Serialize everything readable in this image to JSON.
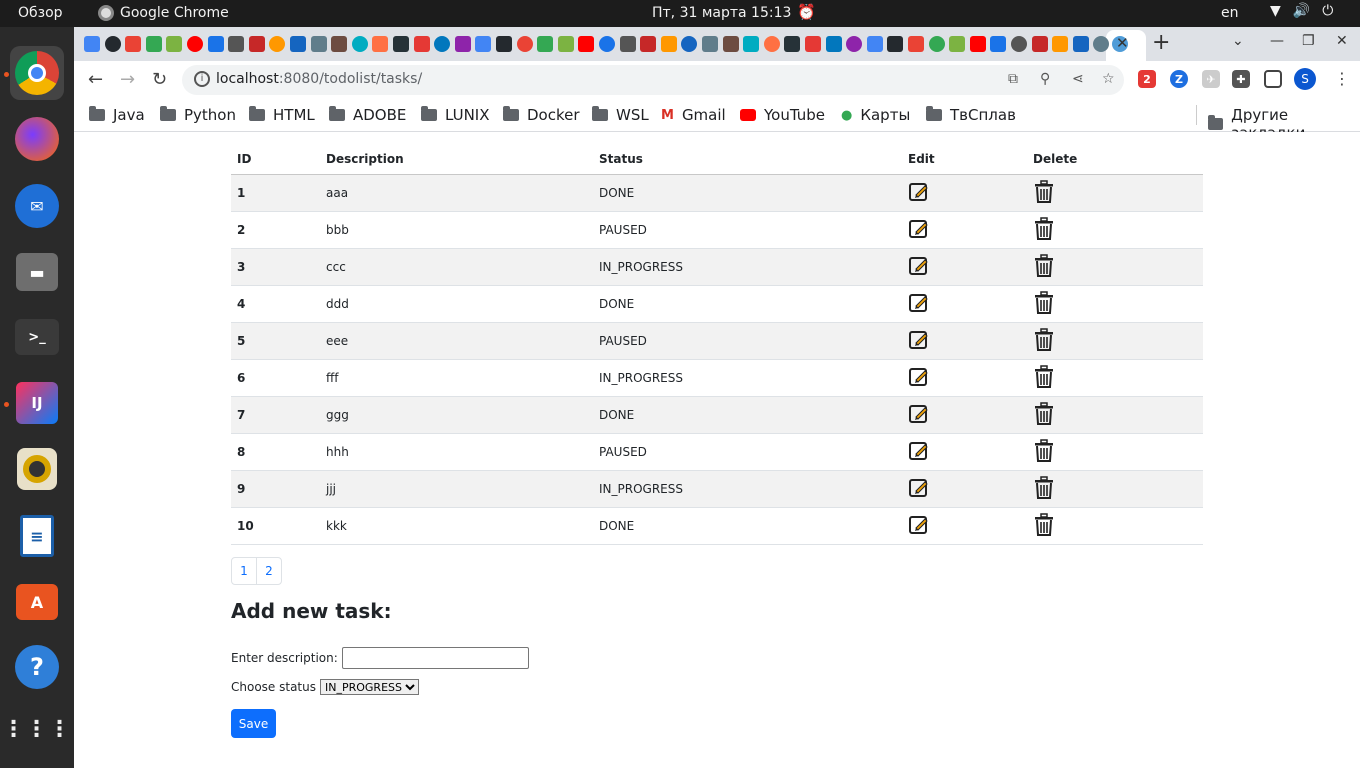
{
  "os": {
    "activities": "Обзор",
    "app_name": "Google Chrome",
    "clock": "Пт, 31 марта  15:13",
    "keyboard_layout": "en"
  },
  "browser": {
    "url_host": "localhost",
    "url_rest": ":8080/todolist/tasks/",
    "profile_initial": "S",
    "bookmarks": [
      "Java",
      "Python",
      "HTML",
      "ADOBE",
      "LUNIX",
      "Docker",
      "WSL",
      "Gmail",
      "YouTube",
      "Карты",
      "ТвСплав"
    ],
    "other_bookmarks": "Другие закладки"
  },
  "table": {
    "headers": {
      "id": "ID",
      "description": "Description",
      "status": "Status",
      "edit": "Edit",
      "delete": "Delete"
    },
    "rows": [
      {
        "id": "1",
        "description": "aaa",
        "status": "DONE"
      },
      {
        "id": "2",
        "description": "bbb",
        "status": "PAUSED"
      },
      {
        "id": "3",
        "description": "ccc",
        "status": "IN_PROGRESS"
      },
      {
        "id": "4",
        "description": "ddd",
        "status": "DONE"
      },
      {
        "id": "5",
        "description": "eee",
        "status": "PAUSED"
      },
      {
        "id": "6",
        "description": "fff",
        "status": "IN_PROGRESS"
      },
      {
        "id": "7",
        "description": "ggg",
        "status": "DONE"
      },
      {
        "id": "8",
        "description": "hhh",
        "status": "PAUSED"
      },
      {
        "id": "9",
        "description": "jjj",
        "status": "IN_PROGRESS"
      },
      {
        "id": "10",
        "description": "kkk",
        "status": "DONE"
      }
    ]
  },
  "pagination": {
    "pages": [
      "1",
      "2"
    ]
  },
  "form": {
    "title": "Add new task:",
    "description_label": "Enter description:",
    "description_value": "",
    "status_label": "Choose status",
    "status_selected": "IN_PROGRESS",
    "save_label": "Save"
  },
  "colors": {
    "primary": "#0d6efd",
    "row_stripe": "#f2f2f2",
    "edit_icon_accent": "#f0a30a"
  }
}
